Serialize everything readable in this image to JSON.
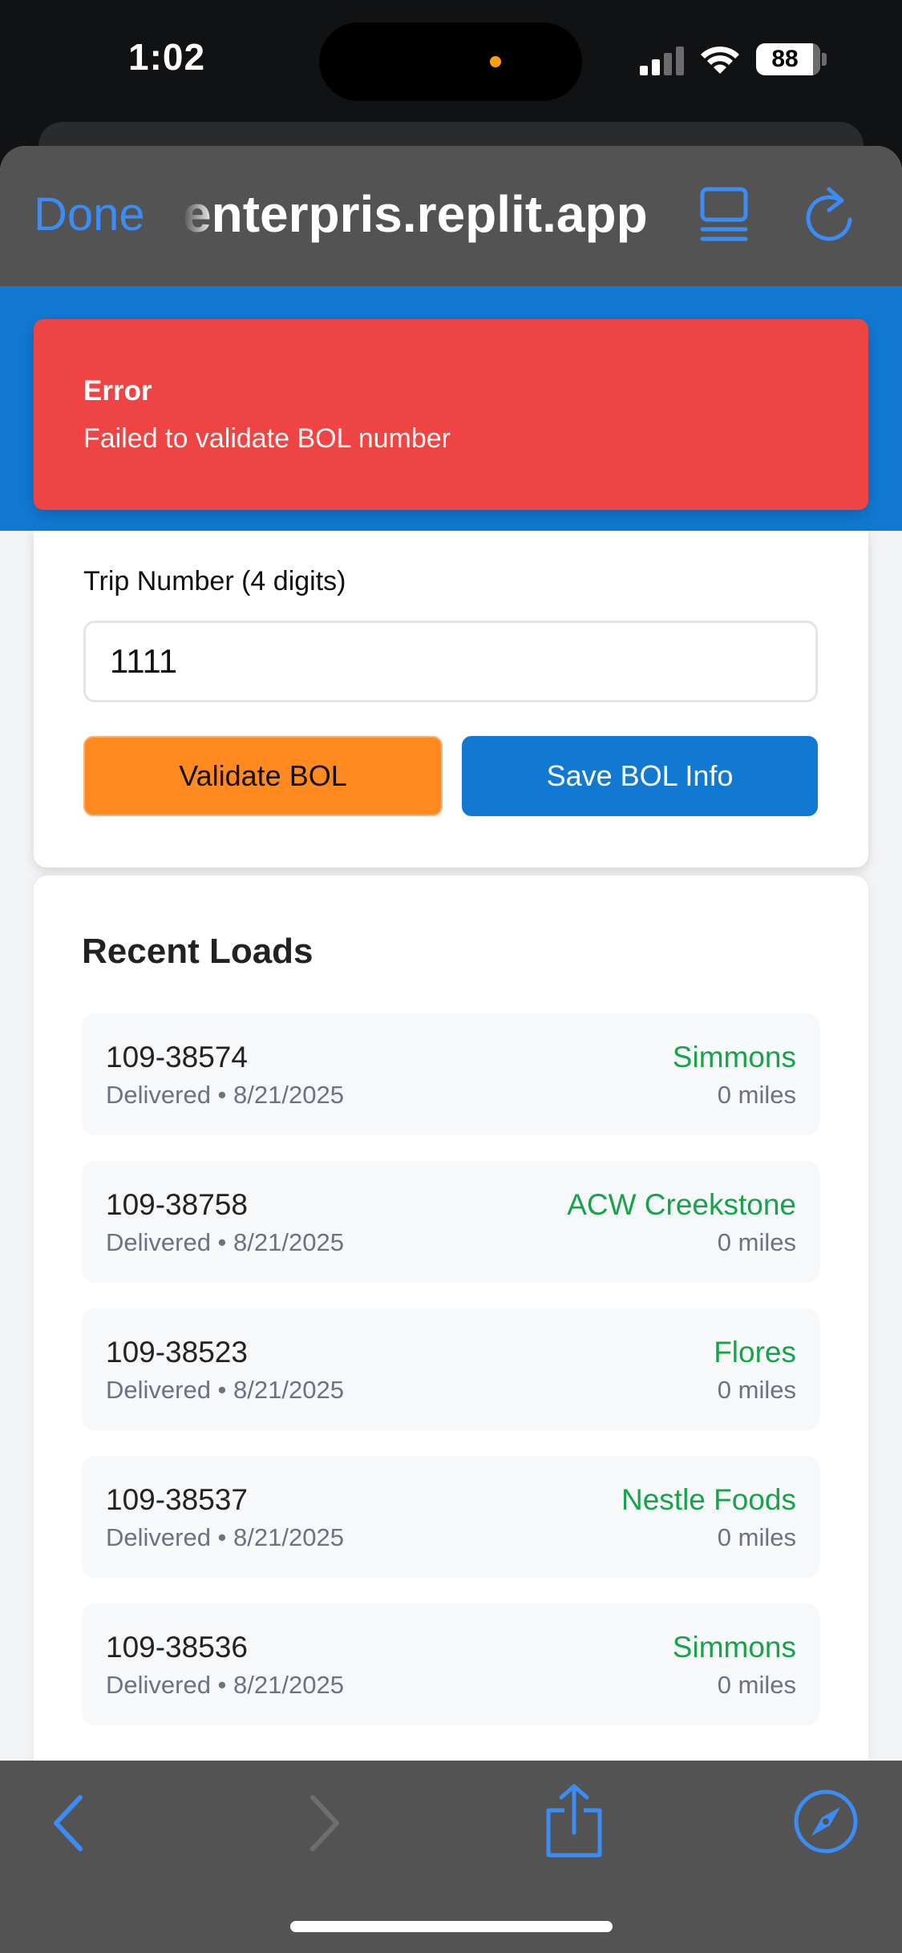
{
  "status_bar": {
    "time": "1:02",
    "battery": "88"
  },
  "browser": {
    "done_label": "Done",
    "url": "enterpris.replit.app"
  },
  "error": {
    "title": "Error",
    "message": "Failed to validate BOL number",
    "color": "#ef4444"
  },
  "form": {
    "trip_label": "Trip Number (4 digits)",
    "trip_value": "1111",
    "validate_label": "Validate BOL",
    "save_label": "Save BOL Info"
  },
  "recent_loads": {
    "title": "Recent Loads",
    "items": [
      {
        "id": "109-38574",
        "meta": "Delivered • 8/21/2025",
        "customer": "Simmons",
        "miles": "0 miles"
      },
      {
        "id": "109-38758",
        "meta": "Delivered • 8/21/2025",
        "customer": "ACW Creekstone",
        "miles": "0 miles"
      },
      {
        "id": "109-38523",
        "meta": "Delivered • 8/21/2025",
        "customer": "Flores",
        "miles": "0 miles"
      },
      {
        "id": "109-38537",
        "meta": "Delivered • 8/21/2025",
        "customer": "Nestle Foods",
        "miles": "0 miles"
      },
      {
        "id": "109-38536",
        "meta": "Delivered • 8/21/2025",
        "customer": "Simmons",
        "miles": "0 miles"
      }
    ]
  },
  "colors": {
    "brand_blue": "#1279d3",
    "accent_orange": "#ff8a1f",
    "customer_green": "#16a34a"
  },
  "icons": {
    "reader": "reader-mode-icon",
    "reload": "reload-icon",
    "back": "chevron-left-icon",
    "forward": "chevron-right-icon",
    "share": "share-icon",
    "compass": "compass-icon"
  }
}
